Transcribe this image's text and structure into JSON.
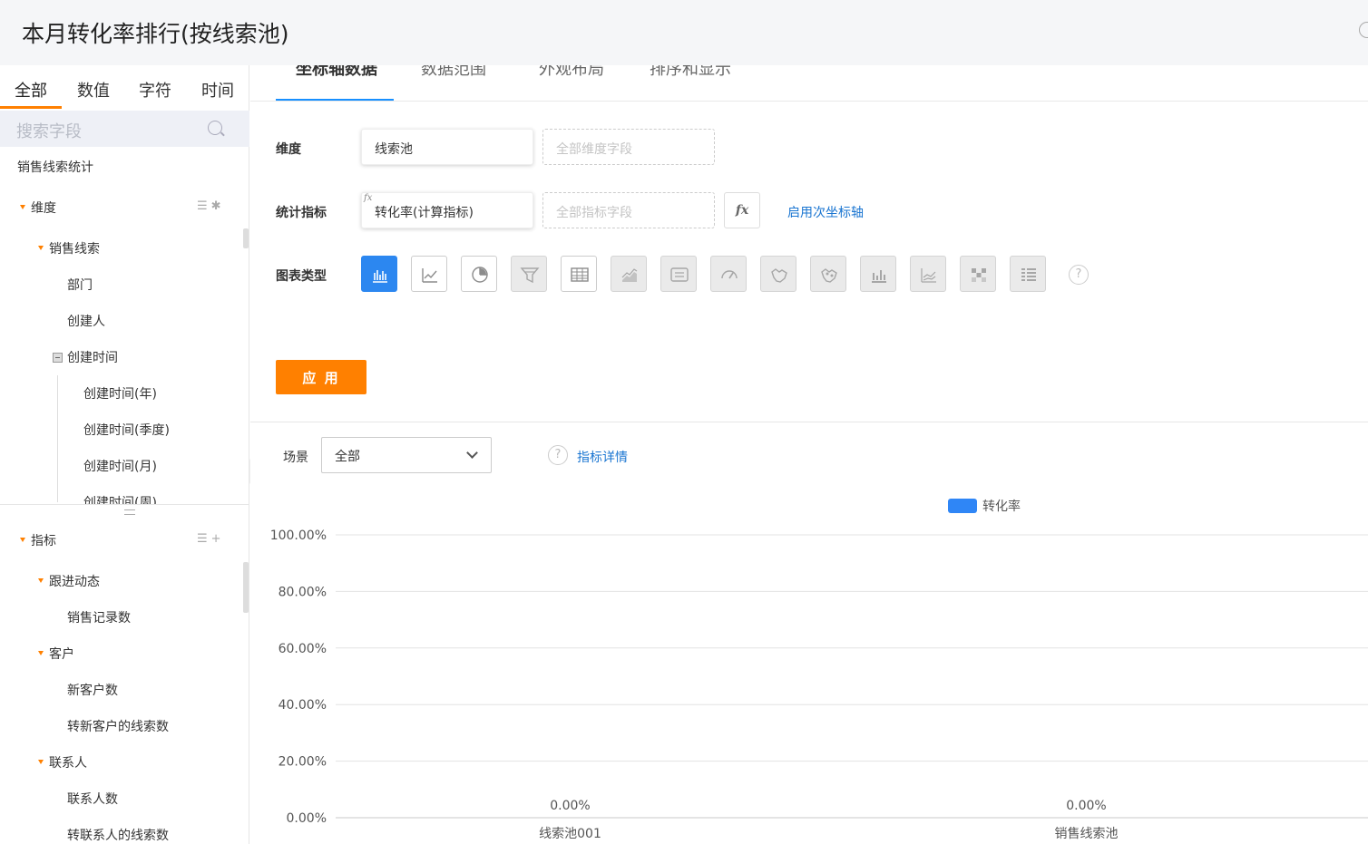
{
  "header": {
    "title": "本月转化率排行(按线索池)"
  },
  "sidebar": {
    "type_tabs": [
      "全部",
      "数值",
      "字符",
      "时间"
    ],
    "search_placeholder": "搜索字段",
    "dataset": "销售线索统计",
    "dimension_section": "维度",
    "dimension_tree": {
      "group": "销售线索",
      "items": [
        "部门",
        "创建人"
      ],
      "time_group": "创建时间",
      "time_items": [
        "创建时间(年)",
        "创建时间(季度)",
        "创建时间(月)",
        "创建时间(周)"
      ]
    },
    "metric_section": "指标",
    "metric_groups": [
      {
        "name": "跟进动态",
        "items": [
          "销售记录数"
        ]
      },
      {
        "name": "客户",
        "items": [
          "新客户数",
          "转新客户的线索数"
        ]
      },
      {
        "name": "联系人",
        "items": [
          "联系人数",
          "转联系人的线索数"
        ]
      }
    ]
  },
  "config_tabs": [
    "坐标轴数据",
    "数据范围",
    "外观布局",
    "排序和显示"
  ],
  "form": {
    "dimension_label": "维度",
    "dimension_value": "线索池",
    "dimension_placeholder": "全部维度字段",
    "metric_label": "统计指标",
    "metric_fx_tag": "fx",
    "metric_value": "转化率(计算指标)",
    "metric_placeholder": "全部指标字段",
    "fx_button": "fx",
    "secondary_axis_link": "启用次坐标轴",
    "chart_type_label": "图表类型",
    "chart_types": [
      {
        "icon": "bar-chart-icon",
        "state": "active"
      },
      {
        "icon": "line-chart-icon",
        "state": "normal"
      },
      {
        "icon": "pie-chart-icon",
        "state": "normal"
      },
      {
        "icon": "funnel-chart-icon",
        "state": "disabled"
      },
      {
        "icon": "table-chart-icon",
        "state": "normal"
      },
      {
        "icon": "area-chart-icon",
        "state": "disabled"
      },
      {
        "icon": "indicator-card-icon",
        "state": "disabled"
      },
      {
        "icon": "gauge-chart-icon",
        "state": "disabled"
      },
      {
        "icon": "map-chart-icon",
        "state": "disabled"
      },
      {
        "icon": "scatter-map-icon",
        "state": "disabled"
      },
      {
        "icon": "combo-bar-icon",
        "state": "disabled"
      },
      {
        "icon": "combo-line-icon",
        "state": "disabled"
      },
      {
        "icon": "heatmap-icon",
        "state": "disabled"
      },
      {
        "icon": "pivot-table-icon",
        "state": "disabled"
      }
    ],
    "help_glyph": "?",
    "apply_button": "应 用"
  },
  "scene": {
    "label": "场景",
    "selected": "全部",
    "help_glyph": "?",
    "metric_details_link": "指标详情"
  },
  "chart_data": {
    "type": "bar",
    "categories": [
      "线索池001",
      "销售线索池"
    ],
    "series": [
      {
        "name": "转化率",
        "values": [
          0,
          0
        ]
      }
    ],
    "value_labels": [
      "0.00%",
      "0.00%"
    ],
    "y_ticks": [
      "0.00%",
      "20.00%",
      "40.00%",
      "60.00%",
      "80.00%",
      "100.00%"
    ],
    "ylim": [
      0,
      100
    ],
    "legend_position": "top-center",
    "grid": true,
    "colors": {
      "series": "#2f86f6"
    }
  }
}
